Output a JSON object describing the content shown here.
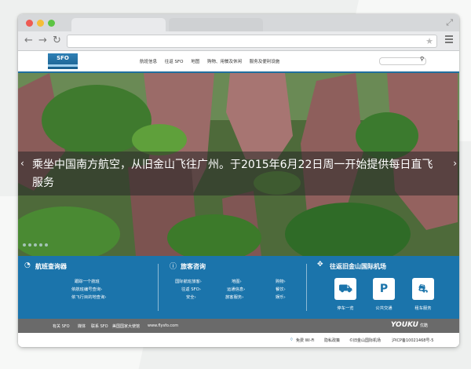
{
  "browser": {
    "back_icon": "back-arrow-icon",
    "forward_icon": "forward-arrow-icon",
    "reload_icon": "reload-icon",
    "bookmark_icon": "star-icon",
    "menu_icon": "hamburger-menu-icon",
    "traffic_lights": [
      "#ee5a52",
      "#f5bd37",
      "#5cc443"
    ]
  },
  "site": {
    "logo_text": "SFO",
    "nav": [
      "航班信息",
      "往返 SFO",
      "地图",
      "购物、用餐及休闲",
      "服务及便利设施"
    ],
    "search_icon": "magnifier-icon"
  },
  "hero": {
    "caption": "乘坐中国南方航空，从旧金山飞往广州。于2015年6月22日周一开始提供每日直飞服务",
    "prev_arrow": "‹",
    "next_arrow": "›"
  },
  "panels": {
    "flights": {
      "title": "航班查询器",
      "links": [
        "跟踪一个航班",
        "依航班编号查询›",
        "依飞行目的地查询›"
      ]
    },
    "visitor": {
      "title": "旅客咨询",
      "links": [
        "国际航班旅客›",
        "往返 SFO›",
        "安全›",
        "地图›",
        "运通信息›",
        "旅客服务›",
        "购物›",
        "餐饮›",
        "娱乐›"
      ]
    },
    "transport": {
      "title": "往返旧金山国际机场",
      "services": [
        {
          "label": "停车一览",
          "icon": "parking-cars-icon"
        },
        {
          "label": "公共交通",
          "icon": "parking-bus-icon"
        },
        {
          "label": "租车服务",
          "icon": "rental-car-icon"
        }
      ]
    }
  },
  "footer": {
    "links": [
      "有关 SFO",
      "媒体",
      "联系 SFO",
      "美国国家大使馆",
      "www.flysfo.com"
    ],
    "brand": "YOUKU",
    "brand_sub": "优酷"
  },
  "status": {
    "items": [
      "免费 Wi-Fi",
      "隐私政策",
      "©旧金山国际机场",
      "沪ICP备10021468号-5"
    ]
  },
  "colors": {
    "accent_blue": "#1b74ab",
    "footer_gray": "#6a6a6a"
  }
}
